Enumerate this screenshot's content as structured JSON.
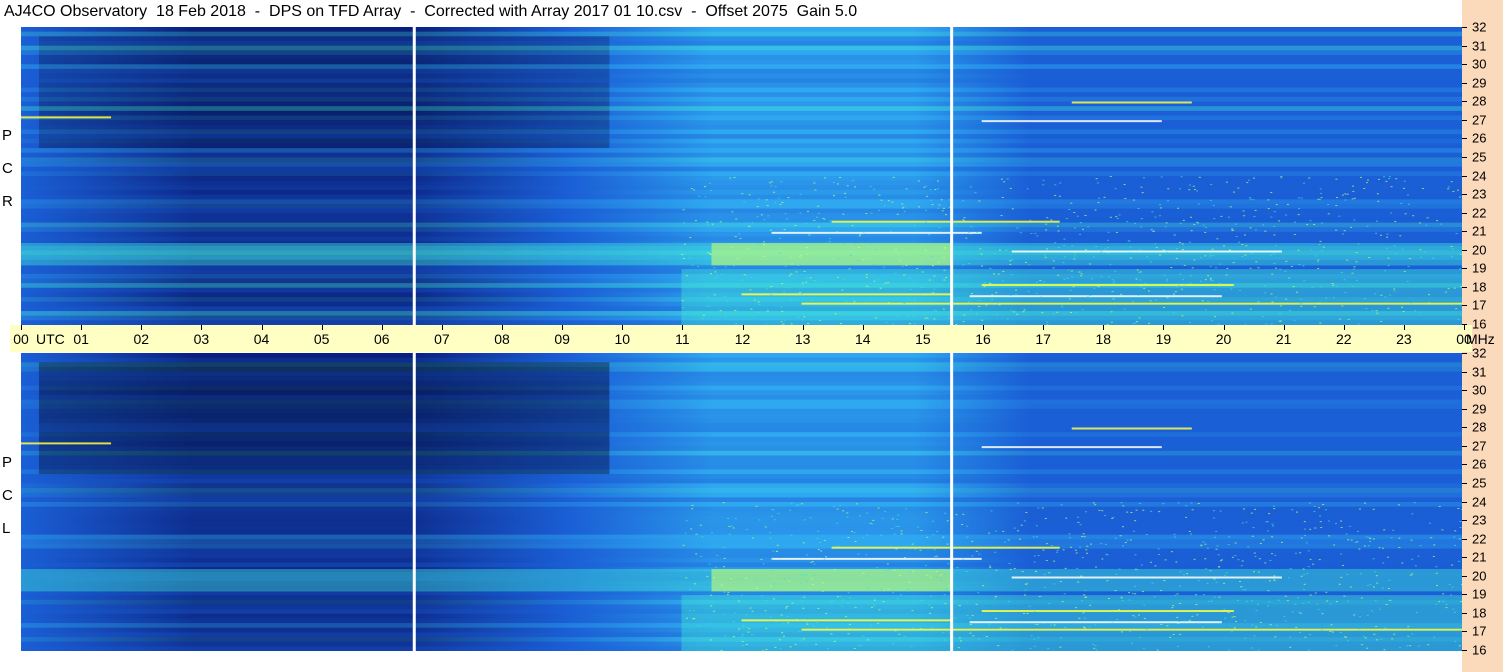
{
  "title": "AJ4CO Observatory  18 Feb 2018  -  DPS on TFD Array  -  Corrected with Array 2017 01 10.csv  -  Offset 2075  Gain 5.0",
  "chart_data": [
    {
      "type": "heatmap",
      "name": "RCP",
      "polarization_label": [
        "R",
        "C",
        "P"
      ],
      "x_label": "UTC",
      "x_ticks": [
        "00",
        "01",
        "02",
        "03",
        "04",
        "05",
        "06",
        "07",
        "08",
        "09",
        "10",
        "11",
        "12",
        "13",
        "14",
        "15",
        "16",
        "17",
        "18",
        "19",
        "20",
        "21",
        "22",
        "23",
        "00"
      ],
      "y_unit": "MHz",
      "y_ticks": [
        32,
        31,
        30,
        29,
        28,
        27,
        26,
        25,
        24,
        23,
        22,
        21,
        20,
        19,
        18,
        17,
        16
      ],
      "ylim": [
        16,
        32
      ],
      "xlim_hours": [
        0,
        24
      ],
      "data_gaps_utc_hours": [
        6.55,
        15.5
      ],
      "colormap": [
        "#000020",
        "#0a1f7a",
        "#1b5fd6",
        "#2fa8f0",
        "#3fe0d8",
        "#c8ff70",
        "#ffff40",
        "#ffffff"
      ]
    },
    {
      "type": "heatmap",
      "name": "LCP",
      "polarization_label": [
        "L",
        "C",
        "P"
      ],
      "x_label": "UTC",
      "x_ticks": [
        "00",
        "01",
        "02",
        "03",
        "04",
        "05",
        "06",
        "07",
        "08",
        "09",
        "10",
        "11",
        "12",
        "13",
        "14",
        "15",
        "16",
        "17",
        "18",
        "19",
        "20",
        "21",
        "22",
        "23",
        "00"
      ],
      "y_unit": "MHz",
      "y_ticks": [
        32,
        31,
        30,
        29,
        28,
        27,
        26,
        25,
        24,
        23,
        22,
        21,
        20,
        19,
        18,
        17,
        16
      ],
      "ylim": [
        16,
        32
      ],
      "xlim_hours": [
        0,
        24
      ],
      "data_gaps_utc_hours": [
        6.55,
        15.5
      ],
      "colormap": [
        "#000020",
        "#0a1f7a",
        "#1b5fd6",
        "#2fa8f0",
        "#3fe0d8",
        "#c8ff70",
        "#ffff40",
        "#ffffff"
      ]
    }
  ],
  "axis": {
    "utc_label": "UTC",
    "mhz_label": "MHz"
  }
}
